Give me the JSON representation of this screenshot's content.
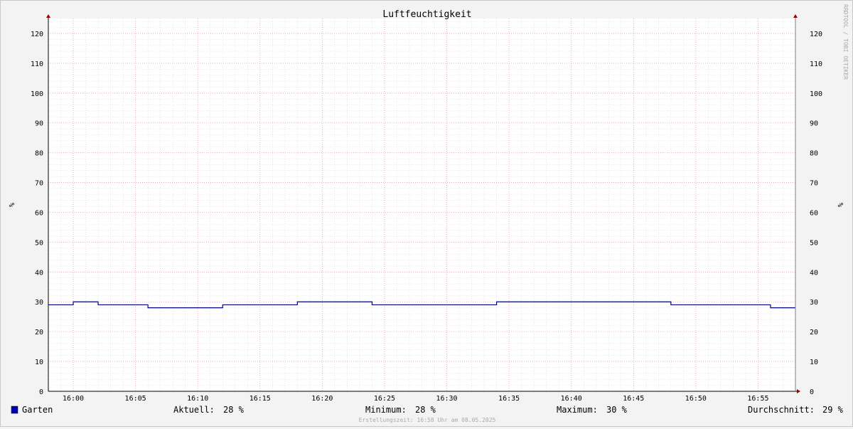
{
  "chart_data": {
    "type": "line",
    "title": "Luftfeuchtigkeit",
    "ylabel": "%",
    "ylabel_right": "%",
    "ylim": [
      0,
      125
    ],
    "yticks": [
      0,
      10,
      20,
      30,
      40,
      50,
      60,
      70,
      80,
      90,
      100,
      110,
      120
    ],
    "xlim": [
      "15:58",
      "16:58"
    ],
    "xtick_labels": [
      "16:00",
      "16:05",
      "16:10",
      "16:15",
      "16:20",
      "16:25",
      "16:30",
      "16:35",
      "16:40",
      "16:45",
      "16:50",
      "16:55"
    ],
    "grid": true,
    "step": true,
    "series": [
      {
        "name": "Garten",
        "color": "#000080",
        "x": [
          "15:58",
          "16:00",
          "16:02",
          "16:06",
          "16:12",
          "16:18",
          "16:24",
          "16:34",
          "16:48",
          "16:56",
          "16:58"
        ],
        "values": [
          29,
          30,
          29,
          28,
          29,
          30,
          29,
          30,
          29,
          28,
          28
        ]
      }
    ],
    "legend_color": "#0000aa",
    "stats": {
      "current_label": "Aktuell:",
      "current": "28 %",
      "min_label": "Minimum:",
      "min": "28 %",
      "max_label": "Maximum:",
      "max": "30 %",
      "avg_label": "Durchschnitt:",
      "avg": "29 %"
    },
    "watermark": "RRDTOOL / TOBI OETIKER",
    "footer": "Erstellungszeit: 16:58 Uhr am 08.05.2025"
  },
  "colors": {
    "background": "#f3f3f3",
    "plot_background": "#ffffff",
    "major_grid": "#e8a0b0",
    "minor_grid": "#d8d8d8",
    "axis": "#808080",
    "arrow": "#a00000"
  }
}
